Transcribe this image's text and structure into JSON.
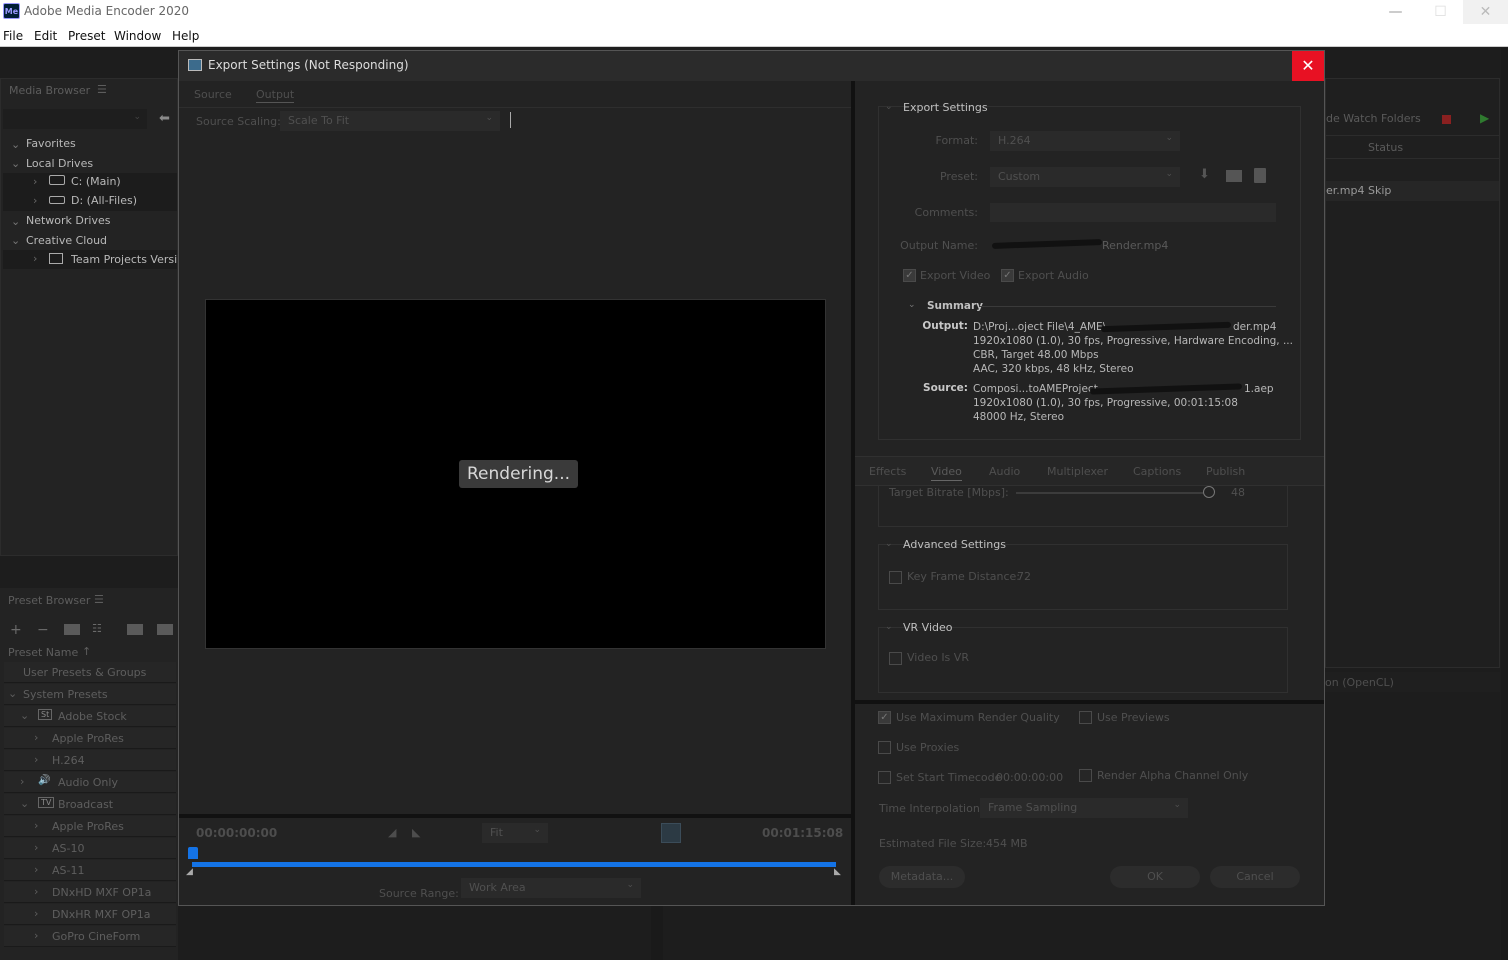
{
  "app": {
    "title": "Adobe Media Encoder 2020",
    "icon_label": "Me",
    "window_controls": [
      "—",
      "☐",
      "✕"
    ]
  },
  "menu": [
    "File",
    "Edit",
    "Preset",
    "Window",
    "Help"
  ],
  "media_browser": {
    "title": "Media Browser",
    "tree": {
      "favorites": "Favorites",
      "local_drives": "Local Drives",
      "drive_c": "C: (Main)",
      "drive_d": "D: (All-Files)",
      "network_drives": "Network Drives",
      "creative_cloud": "Creative Cloud",
      "team_projects": "Team Projects Versions"
    }
  },
  "preset_browser": {
    "title": "Preset Browser",
    "column": "Preset Name",
    "user_presets": "User Presets & Groups",
    "system_presets": "System Presets",
    "items": [
      {
        "label": "Adobe Stock",
        "indent": 1,
        "badge": "St"
      },
      {
        "label": "Apple ProRes",
        "indent": 2
      },
      {
        "label": "H.264",
        "indent": 2
      },
      {
        "label": "Audio Only",
        "indent": 1
      },
      {
        "label": "Broadcast",
        "indent": 1,
        "badge": "TV"
      },
      {
        "label": "Apple ProRes",
        "indent": 2
      },
      {
        "label": "AS-10",
        "indent": 2
      },
      {
        "label": "AS-11",
        "indent": 2
      },
      {
        "label": "DNxHD MXF OP1a",
        "indent": 2
      },
      {
        "label": "DNxHR MXF OP1a",
        "indent": 2
      },
      {
        "label": "GoPro CineForm",
        "indent": 2
      }
    ]
  },
  "right_panel": {
    "watch_folders": "Auto-Encode Watch Folders",
    "watch_folders_partial": "de Watch Folders",
    "status_header": "Status",
    "queue_file": "er.mp4",
    "queue_status": "Skip",
    "renderer": "on (OpenCL)"
  },
  "dialog": {
    "title": "Export Settings (Not Responding)",
    "close": "✕",
    "tabs": [
      "Source",
      "Output"
    ],
    "source_scaling_label": "Source Scaling:",
    "source_scaling_value": "Scale To Fit",
    "rendering_label": "Rendering...",
    "timecode_start": "00:00:00:00",
    "timecode_end": "00:01:15:08",
    "fit_value": "Fit",
    "source_range_label": "Source Range:",
    "source_range_value": "Work Area",
    "export_settings": {
      "title": "Export Settings",
      "format_label": "Format:",
      "format_value": "H.264",
      "preset_label": "Preset:",
      "preset_value": "Custom",
      "comments_label": "Comments:",
      "output_name_label": "Output Name:",
      "output_name_value": "Render.mp4",
      "export_video": "Export Video",
      "export_audio": "Export Audio",
      "summary_title": "Summary",
      "output_key": "Output:",
      "output_lines": [
        "D:\\Proj...oject File\\4_AME\\",
        "1920x1080 (1.0), 30 fps, Progressive, Hardware Encoding, ...",
        "CBR, Target 48.00 Mbps",
        "AAC, 320 kbps, 48 kHz, Stereo"
      ],
      "output_suffix": "der.mp4",
      "source_key": "Source:",
      "source_lines": [
        "Composi...toAMEProject",
        "1920x1080 (1.0), 30 fps, Progressive, 00:01:15:08",
        "48000 Hz, Stereo"
      ],
      "source_suffix": "1.aep"
    },
    "settings_tabs": [
      "Effects",
      "Video",
      "Audio",
      "Multiplexer",
      "Captions",
      "Publish"
    ],
    "active_settings_tab": "Video",
    "target_bitrate_label": "Target Bitrate [Mbps]:",
    "target_bitrate_value": "48",
    "advanced_title": "Advanced Settings",
    "key_frame_label": "Key Frame Distance:",
    "key_frame_value": "72",
    "vr_title": "VR Video",
    "vr_label": "Video Is VR",
    "use_max_render": "Use Maximum Render Quality",
    "use_previews": "Use Previews",
    "use_proxies": "Use Proxies",
    "set_start_tc": "Set Start Timecode",
    "start_tc_value": "00:00:00:00",
    "render_alpha": "Render Alpha Channel Only",
    "time_interp_label": "Time Interpolation:",
    "time_interp_value": "Frame Sampling",
    "est_size_label": "Estimated File Size:",
    "est_size_value": "454 MB",
    "metadata_btn": "Metadata...",
    "ok_btn": "OK",
    "cancel_btn": "Cancel"
  }
}
